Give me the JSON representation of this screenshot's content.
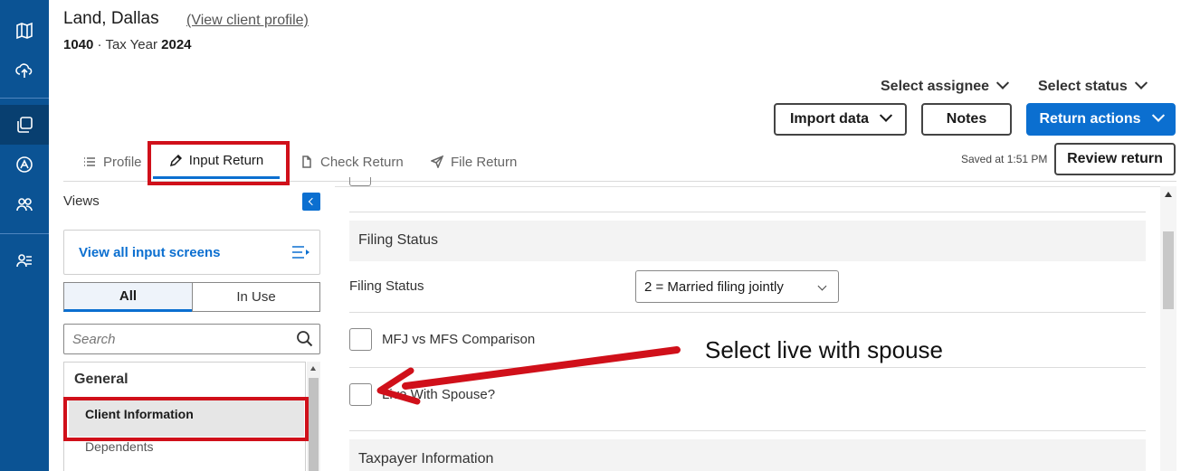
{
  "header": {
    "client_name": "Land, Dallas",
    "view_profile_link": "(View client profile)",
    "form": "1040",
    "separator": " · ",
    "tax_year_label": "Tax Year ",
    "tax_year": "2024"
  },
  "toolbar": {
    "select_assignee": "Select assignee",
    "select_status": "Select status",
    "import_data": "Import data",
    "notes": "Notes",
    "return_actions": "Return actions",
    "review_return": "Review return",
    "saved_text": "Saved at 1:51 PM"
  },
  "tabs": [
    {
      "label": "Profile",
      "icon": "list-icon"
    },
    {
      "label": "Input Return",
      "icon": "pencil-icon"
    },
    {
      "label": "Check Return",
      "icon": "document-icon"
    },
    {
      "label": "File Return",
      "icon": "send-icon"
    }
  ],
  "sidebar": {
    "views_label": "Views",
    "view_all": "View all input screens",
    "toggle_all": "All",
    "toggle_in_use": "In Use",
    "search_placeholder": "Search",
    "group": "General",
    "items": [
      "Client Information",
      "Dependents"
    ]
  },
  "main": {
    "section_filing": "Filing Status",
    "filing_status_label": "Filing Status",
    "filing_status_value": "2 = Married filing jointly",
    "mfj_checkbox_label": "MFJ vs MFS Comparison",
    "live_with_spouse_label": "Live With Spouse?",
    "section_taxpayer": "Taxpayer Information"
  },
  "annotation": {
    "text": "Select live with spouse",
    "color": "#d0101a"
  },
  "colors": {
    "rail": "#0b5394",
    "accent": "#0b6fd0"
  }
}
